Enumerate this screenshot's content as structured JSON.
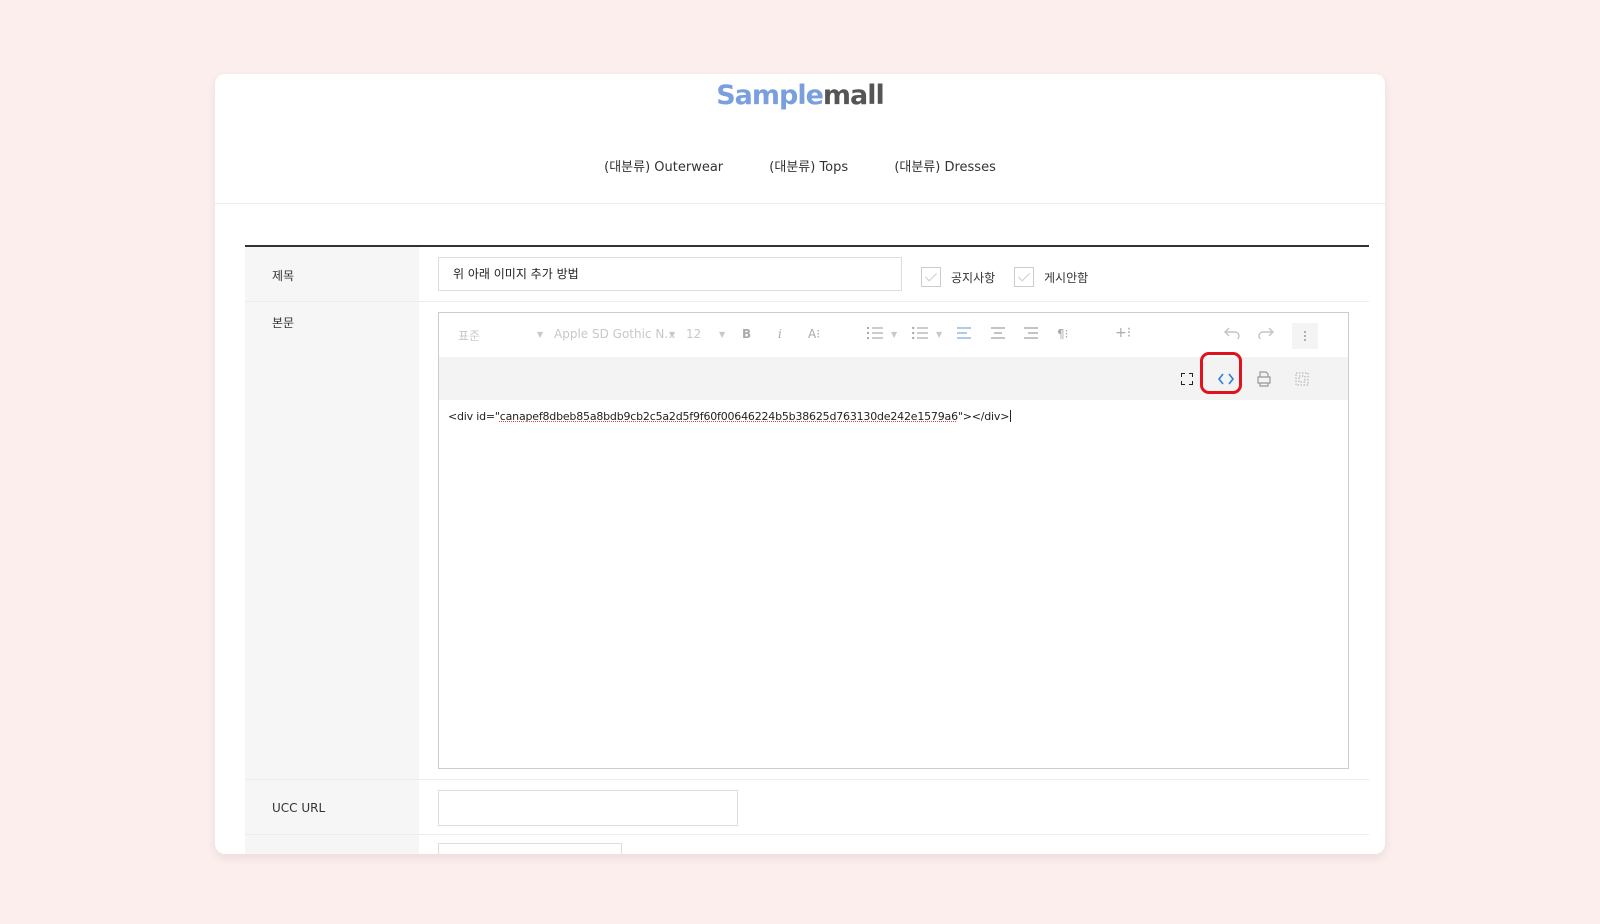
{
  "logo": {
    "part1": "Sample",
    "part2": "mall"
  },
  "nav": [
    "(대분류) Outerwear",
    "(대분류) Tops",
    "(대분류) Dresses"
  ],
  "form": {
    "title_label": "제목",
    "title_value": "위 아래 이미지 추가 방법",
    "notice_label": "공지사항",
    "hidden_label": "게시안함",
    "body_label": "본문",
    "ucc_label": "UCC URL"
  },
  "editor": {
    "toolbar": {
      "paragraph_style": "표준",
      "font_family": "Apple SD Gothic N...",
      "font_size": "12",
      "bold": "B",
      "italic": "i",
      "font_color": "A⁝",
      "insert": "+⁝"
    },
    "code_prefix": "<div id=\"",
    "code_id": "canapef8dbeb85a8bdb9cb2c5a2d5f9f60f00646224b5b38625d763130de242e1579a6",
    "code_suffix": "\"></div>"
  },
  "colors": {
    "background": "#fdeeee",
    "logo_accent": "#7a9fde",
    "highlight": "#e0131c",
    "code_icon": "#2e7ddb"
  }
}
